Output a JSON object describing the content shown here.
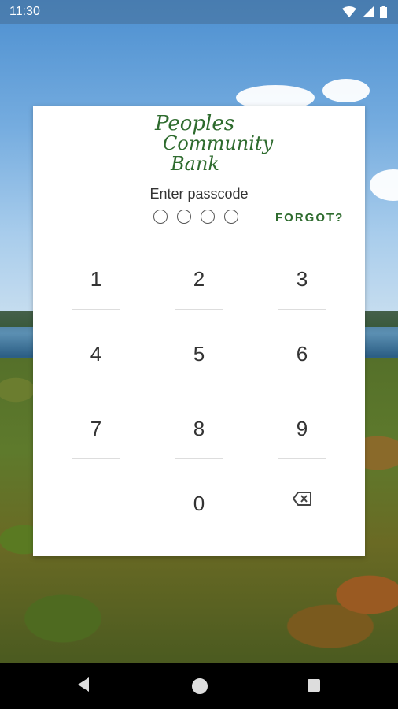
{
  "status_bar": {
    "time": "11:30"
  },
  "logo": {
    "line1": "Peoples",
    "line2": "Community",
    "line3": "Bank"
  },
  "prompt": "Enter passcode",
  "forgot_label": "FORGOT?",
  "passcode_dots": 4,
  "keypad": [
    "1",
    "2",
    "3",
    "4",
    "5",
    "6",
    "7",
    "8",
    "9",
    "0"
  ],
  "colors": {
    "brand_green": "#2e6b2e"
  },
  "icons": {
    "backspace": "backspace-icon",
    "back": "back-icon",
    "home": "home-icon",
    "recents": "recents-icon"
  }
}
